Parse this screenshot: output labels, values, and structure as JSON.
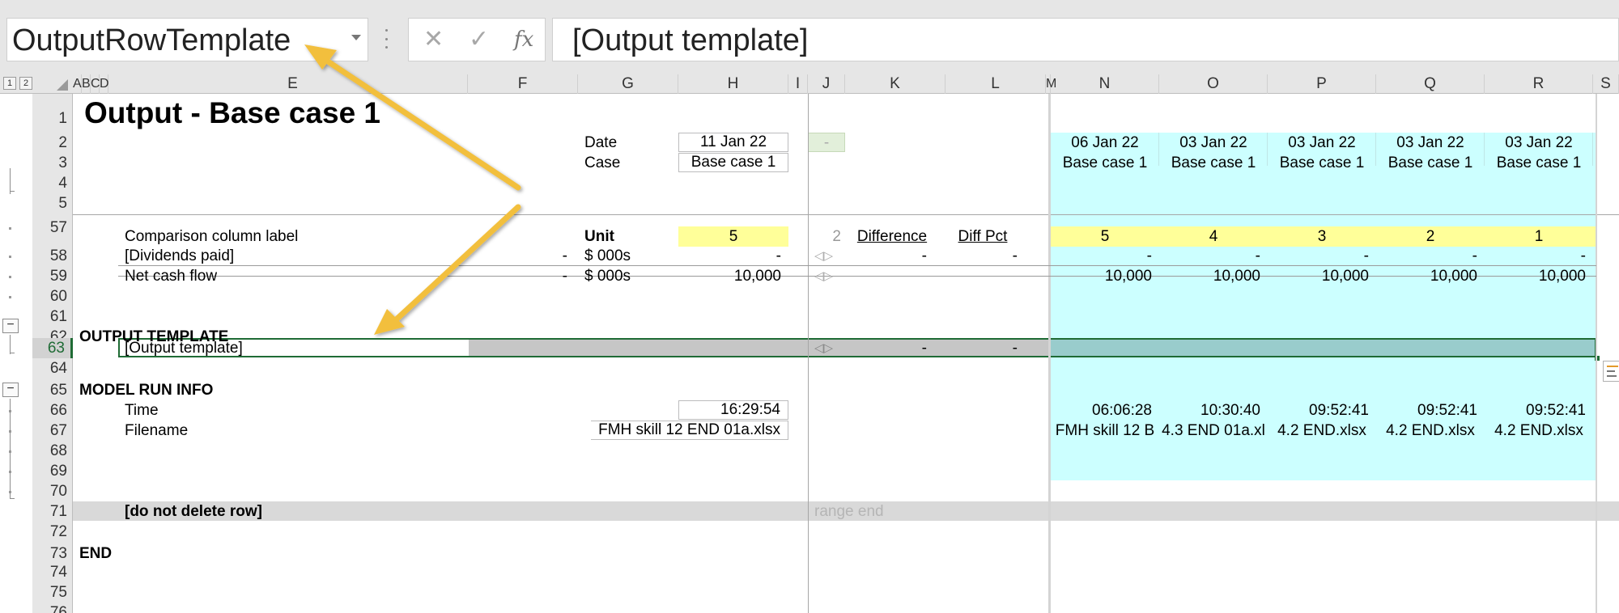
{
  "formula_bar": {
    "name_box": "OutputRowTemplate",
    "cancel_glyph": "✕",
    "enter_glyph": "✓",
    "fx_glyph": "fx",
    "formula": "[Output template]"
  },
  "outline_levels": [
    "1",
    "2"
  ],
  "column_headers": [
    "A",
    "B",
    "C",
    "D",
    "E",
    "F",
    "G",
    "H",
    "I",
    "J",
    "K",
    "L",
    "M",
    "N",
    "O",
    "P",
    "Q",
    "R",
    "S"
  ],
  "row_numbers": [
    "1",
    "2",
    "3",
    "4",
    "5",
    "57",
    "58",
    "59",
    "60",
    "61",
    "62",
    "63",
    "64",
    "65",
    "66",
    "67",
    "68",
    "69",
    "70",
    "71",
    "72",
    "73",
    "74",
    "75",
    "76"
  ],
  "selected_row": "63",
  "outline_minus": "−",
  "sheet": {
    "title": "Output - Base case 1",
    "date_label": "Date",
    "date_value": "11 Jan 22",
    "j2_value": "-",
    "case_label": "Case",
    "case_value": "Base case 1",
    "comparison_label": "Comparison column label",
    "unit_label": "Unit",
    "unit_value": "5",
    "j5_value": "2",
    "difference_header": "Difference",
    "diffpct_header": "Diff Pct",
    "dividends": {
      "label": "[Dividends paid]",
      "f": "-",
      "unit": "$ 000s",
      "h": "-",
      "j": "◁▷",
      "k": "-",
      "l": "-",
      "runs": [
        "-",
        "-",
        "-",
        "-",
        "-"
      ]
    },
    "net_cash": {
      "label": "Net cash flow",
      "f": "-",
      "unit": "$ 000s",
      "h": "10,000",
      "j": "◁▷",
      "runs": [
        "10,000",
        "10,000",
        "10,000",
        "10,000",
        "10,000"
      ]
    },
    "output_template_heading": "OUTPUT TEMPLATE",
    "output_template_row": {
      "label": "[Output template]",
      "j": "◁▷",
      "k": "-",
      "l": "-"
    },
    "model_run_info_heading": "MODEL RUN INFO",
    "time_label": "Time",
    "time_value": "16:29:54",
    "filename_label": "Filename",
    "filename_value": "FMH skill 12 END 01a.xlsx",
    "do_not_delete": "[do not delete row]",
    "range_end": "range end",
    "end_label": "END"
  },
  "runs": [
    {
      "col": "N",
      "date": "06 Jan 22",
      "case": "Base case 1",
      "unit": "5",
      "time": "06:06:28",
      "filename": "FMH skill 12 B"
    },
    {
      "col": "O",
      "date": "03 Jan 22",
      "case": "Base case 1",
      "unit": "4",
      "time": "10:30:40",
      "filename": "4.3 END 01a.xl"
    },
    {
      "col": "P",
      "date": "03 Jan 22",
      "case": "Base case 1",
      "unit": "3",
      "time": "09:52:41",
      "filename": "4.2 END.xlsx"
    },
    {
      "col": "Q",
      "date": "03 Jan 22",
      "case": "Base case 1",
      "unit": "2",
      "time": "09:52:41",
      "filename": "4.2 END.xlsx"
    },
    {
      "col": "R",
      "date": "03 Jan 22",
      "case": "Base case 1",
      "unit": "1",
      "time": "09:52:41",
      "filename": "4.2 END.xlsx"
    }
  ],
  "colors": {
    "run_fill": "#ccffff",
    "run_fill_selected": "#99cccc",
    "unit_fill": "#ffff99",
    "selection_border": "#1f6b35",
    "arrow": "#f2bf3c",
    "heading_green": "#1f6b35"
  }
}
